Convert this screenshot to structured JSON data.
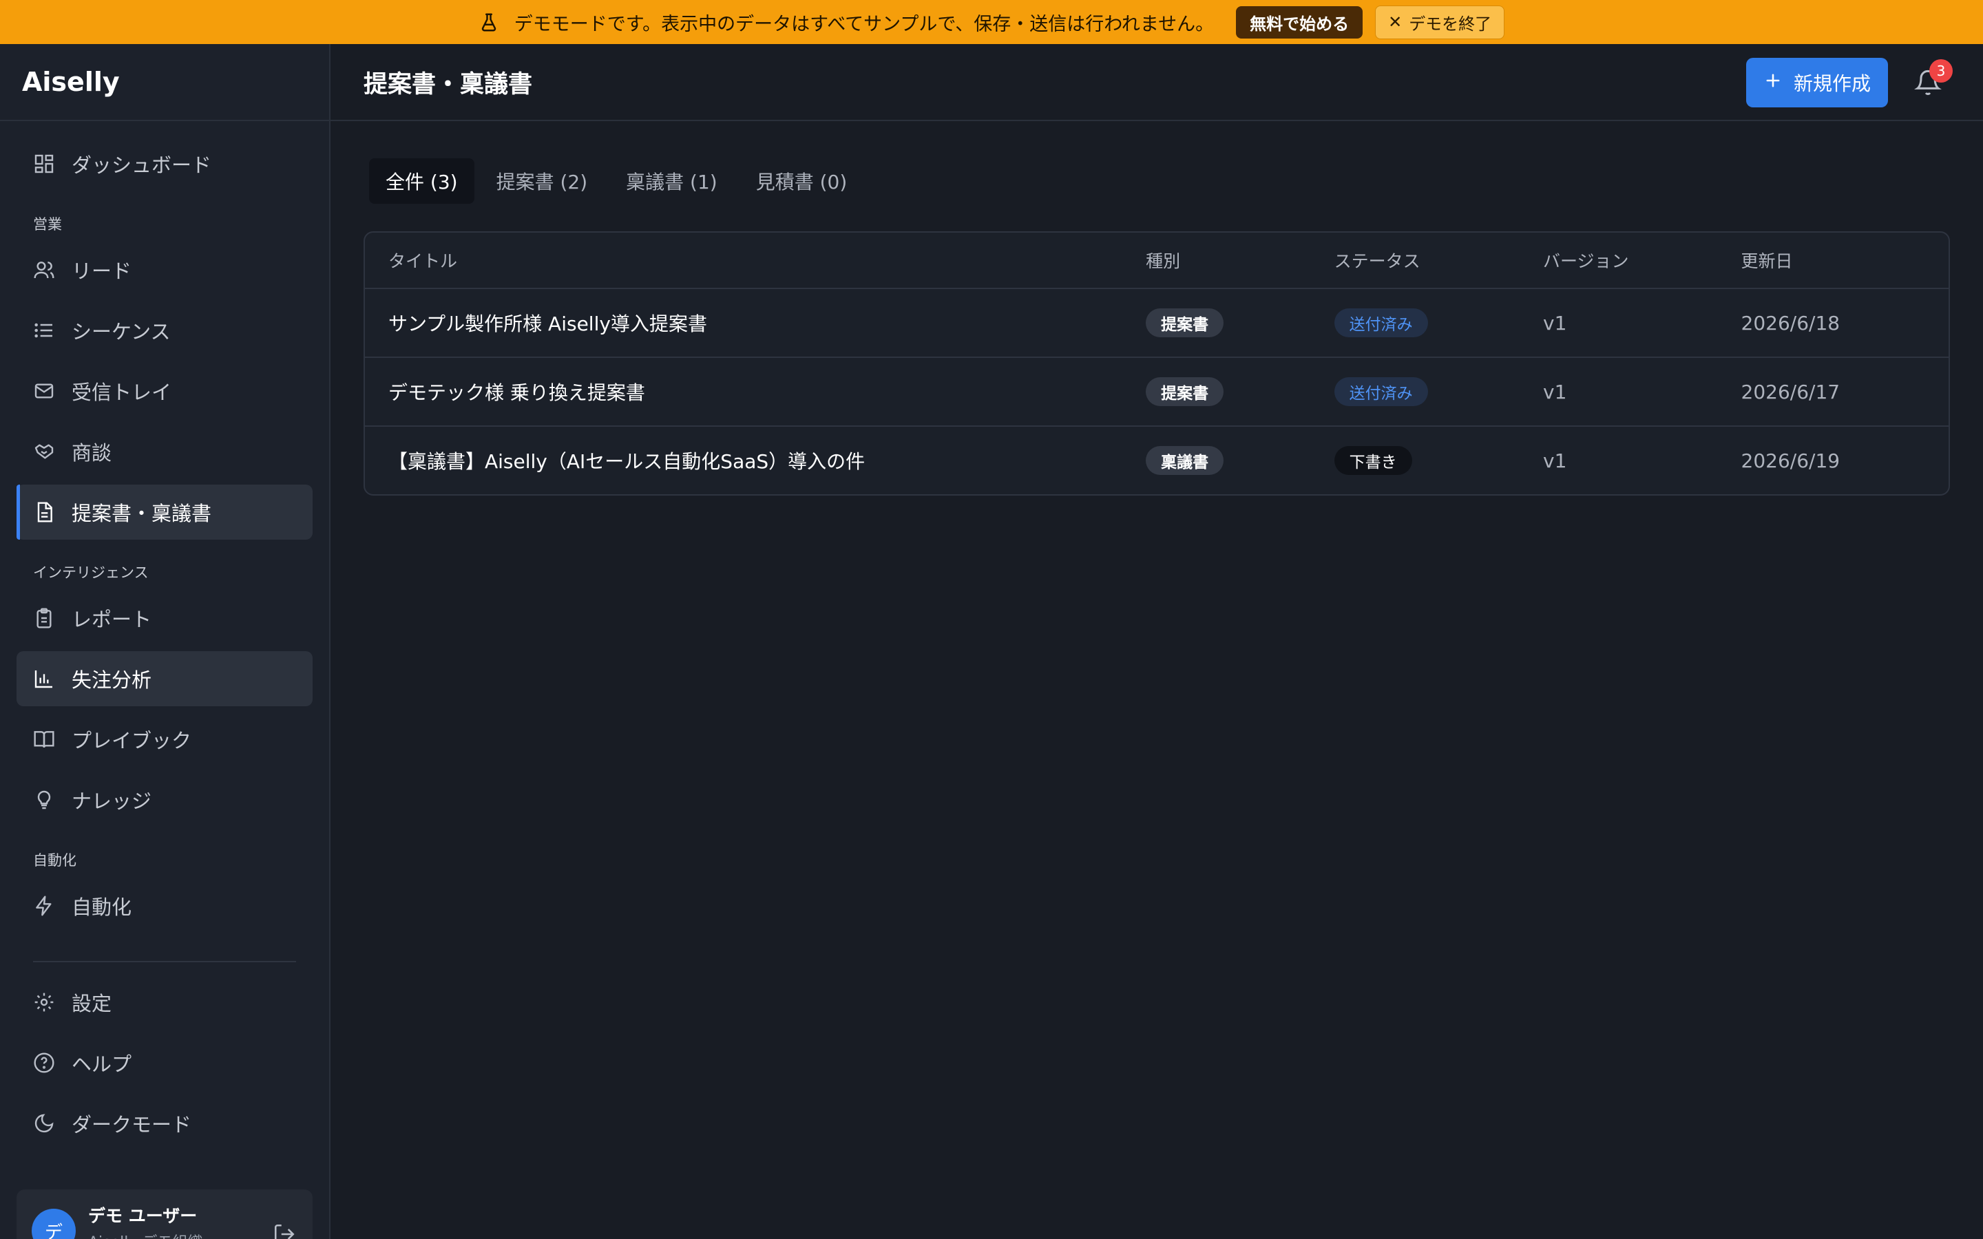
{
  "banner": {
    "message": "デモモードです。表示中のデータはすべてサンプルで、保存・送信は行われません。",
    "start_label": "無料で始める",
    "end_label": "デモを終了",
    "color": "#f59e0b"
  },
  "sidebar": {
    "brand": "Aiselly",
    "items": [
      {
        "label": "ダッシュボード",
        "icon": "grid-icon"
      },
      {
        "section": "営業"
      },
      {
        "label": "リード",
        "icon": "users-icon"
      },
      {
        "label": "シーケンス",
        "icon": "list-icon"
      },
      {
        "label": "受信トレイ",
        "icon": "mail-icon"
      },
      {
        "label": "商談",
        "icon": "handshake-icon"
      },
      {
        "label": "提案書・稟議書",
        "icon": "document-icon",
        "active": true
      },
      {
        "section": "インテリジェンス"
      },
      {
        "label": "レポート",
        "icon": "clipboard-icon"
      },
      {
        "label": "失注分析",
        "icon": "bar-chart-icon",
        "hover": true
      },
      {
        "label": "プレイブック",
        "icon": "book-icon"
      },
      {
        "label": "ナレッジ",
        "icon": "lightbulb-icon"
      },
      {
        "section": "自動化"
      },
      {
        "label": "自動化",
        "icon": "bolt-icon"
      }
    ],
    "bottom_items": [
      {
        "label": "設定",
        "icon": "gear-icon"
      },
      {
        "label": "ヘルプ",
        "icon": "help-icon"
      },
      {
        "label": "ダークモード",
        "icon": "moon-icon"
      }
    ],
    "user": {
      "initial": "デ",
      "name": "デモ ユーザー",
      "org": "Aiselly デモ組織"
    }
  },
  "header": {
    "title": "提案書・稟議書",
    "new_label": "新規作成",
    "notification_count": "3",
    "accent": "#2f7be8"
  },
  "tabs": [
    {
      "label": "全件 (3)",
      "active": true
    },
    {
      "label": "提案書 (2)"
    },
    {
      "label": "稟議書 (1)"
    },
    {
      "label": "見積書 (0)"
    }
  ],
  "table": {
    "columns": [
      "タイトル",
      "種別",
      "ステータス",
      "バージョン",
      "更新日"
    ],
    "rows": [
      {
        "title": "サンプル製作所様 Aiselly導入提案書",
        "type": "提案書",
        "status": "送付済み",
        "status_kind": "sent",
        "version": "v1",
        "updated": "2026/6/18"
      },
      {
        "title": "デモテック様 乗り換え提案書",
        "type": "提案書",
        "status": "送付済み",
        "status_kind": "sent",
        "version": "v1",
        "updated": "2026/6/17"
      },
      {
        "title": "【稟議書】Aiselly（AIセールス自動化SaaS）導入の件",
        "type": "稟議書",
        "status": "下書き",
        "status_kind": "draft",
        "version": "v1",
        "updated": "2026/6/19"
      }
    ]
  }
}
